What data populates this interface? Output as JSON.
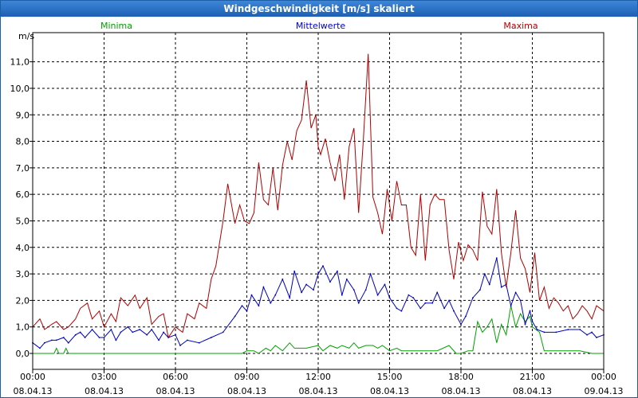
{
  "window": {
    "title": "Windgeschwindigkeit [m/s] skaliert"
  },
  "chart_data": {
    "type": "line",
    "title": "Windgeschwindigkeit [m/s] skaliert",
    "ylabel": "m/s",
    "ylim": [
      -0.6,
      12.1
    ],
    "xlim": [
      0,
      24
    ],
    "yticks": [
      "0,0",
      "1,0",
      "2,0",
      "3,0",
      "4,0",
      "5,0",
      "6,0",
      "7,0",
      "8,0",
      "9,0",
      "10,0",
      "11,0"
    ],
    "xticks": [
      {
        "time": "00:00",
        "date": "08.04.13"
      },
      {
        "time": "03:00",
        "date": "08.04.13"
      },
      {
        "time": "06:00",
        "date": "08.04.13"
      },
      {
        "time": "09:00",
        "date": "08.04.13"
      },
      {
        "time": "12:00",
        "date": "08.04.13"
      },
      {
        "time": "15:00",
        "date": "08.04.13"
      },
      {
        "time": "18:00",
        "date": "08.04.13"
      },
      {
        "time": "21:00",
        "date": "08.04.13"
      },
      {
        "time": "00:00",
        "date": "09.04.13"
      }
    ],
    "grid": true,
    "legend_position": "top",
    "series": [
      {
        "name": "Minima",
        "color": "#00a000",
        "x": [
          0,
          0.5,
          0.9,
          1.0,
          1.1,
          1.3,
          1.4,
          1.5,
          1.7,
          2,
          3,
          4,
          5,
          6,
          7,
          7.5,
          8,
          8.5,
          8.8,
          9,
          9.3,
          9.5,
          9.8,
          10,
          10.2,
          10.5,
          10.8,
          11,
          11.5,
          12,
          12.2,
          12.5,
          12.8,
          13,
          13.3,
          13.5,
          13.7,
          14,
          14.3,
          14.5,
          14.7,
          15,
          15.3,
          15.5,
          16,
          16.5,
          17,
          17.5,
          17.8,
          18,
          18.3,
          18.5,
          18.7,
          18.9,
          19.1,
          19.3,
          19.5,
          19.7,
          19.9,
          20.1,
          20.3,
          20.5,
          20.7,
          20.9,
          21,
          21.3,
          21.5,
          22,
          22.5,
          23,
          23.5,
          24
        ],
        "y": [
          0,
          0,
          0,
          0.2,
          0,
          0,
          0.2,
          0,
          0,
          0,
          0,
          0,
          0,
          0,
          0,
          0,
          0,
          0,
          0,
          0.1,
          0.1,
          0,
          0.2,
          0.1,
          0.3,
          0.1,
          0.4,
          0.2,
          0.2,
          0.3,
          0.1,
          0.3,
          0.2,
          0.3,
          0.2,
          0.4,
          0.2,
          0.3,
          0.3,
          0.2,
          0.3,
          0.1,
          0.2,
          0.1,
          0.1,
          0.1,
          0.1,
          0.3,
          0,
          0,
          0.1,
          0.1,
          1.2,
          0.8,
          1,
          1.3,
          0.4,
          1.1,
          0.7,
          1.8,
          1,
          1.5,
          1.2,
          1.4,
          1,
          0.8,
          0.1,
          0.1,
          0.1,
          0.1,
          0,
          0
        ]
      },
      {
        "name": "Mittelwerte",
        "color": "#0000c0",
        "x": [
          0,
          0.3,
          0.5,
          0.8,
          1.0,
          1.3,
          1.5,
          1.8,
          2,
          2.2,
          2.5,
          2.8,
          3,
          3.3,
          3.5,
          3.7,
          4,
          4.2,
          4.5,
          4.8,
          5,
          5.3,
          5.5,
          5.7,
          6,
          6.2,
          6.5,
          7,
          7.5,
          8,
          8.5,
          8.8,
          9,
          9.2,
          9.5,
          9.7,
          10,
          10.2,
          10.5,
          10.8,
          11,
          11.3,
          11.5,
          11.8,
          12,
          12.2,
          12.5,
          12.8,
          13,
          13.2,
          13.5,
          13.7,
          14,
          14.2,
          14.5,
          14.8,
          15,
          15.3,
          15.5,
          15.8,
          16,
          16.3,
          16.5,
          16.8,
          17,
          17.3,
          17.5,
          17.7,
          18,
          18.2,
          18.5,
          18.8,
          19,
          19.2,
          19.5,
          19.7,
          19.9,
          20.1,
          20.3,
          20.5,
          20.7,
          20.9,
          21,
          21.2,
          21.5,
          22,
          22.5,
          23,
          23.3,
          23.5,
          23.7,
          24
        ],
        "y": [
          0.4,
          0.2,
          0.4,
          0.5,
          0.5,
          0.6,
          0.4,
          0.7,
          0.8,
          0.6,
          0.9,
          0.6,
          0.6,
          0.9,
          0.5,
          0.8,
          1.0,
          0.8,
          0.9,
          0.7,
          0.9,
          0.5,
          0.8,
          0.6,
          0.7,
          0.3,
          0.5,
          0.4,
          0.6,
          0.8,
          1.4,
          1.8,
          1.6,
          2.2,
          1.8,
          2.5,
          1.9,
          2.2,
          2.8,
          2.1,
          3.1,
          2.3,
          2.6,
          2.4,
          3.0,
          3.3,
          2.7,
          3.1,
          2.2,
          2.8,
          2.4,
          1.9,
          2.4,
          3.0,
          2.2,
          2.6,
          2.1,
          1.7,
          1.6,
          2.2,
          2.1,
          1.7,
          1.9,
          1.9,
          2.3,
          1.7,
          2.0,
          1.6,
          1.1,
          1.4,
          2.1,
          2.4,
          3.0,
          2.6,
          3.6,
          2.5,
          2.6,
          1.8,
          2.3,
          2.0,
          1.1,
          1.6,
          1.2,
          0.9,
          0.8,
          0.8,
          0.9,
          0.9,
          0.7,
          0.8,
          0.6,
          0.7
        ],
        "marked": true
      },
      {
        "name": "Maxima",
        "color": "#b00000",
        "x": [
          0,
          0.3,
          0.5,
          0.8,
          1.0,
          1.3,
          1.5,
          1.8,
          2,
          2.3,
          2.5,
          2.8,
          3,
          3.3,
          3.5,
          3.7,
          4,
          4.3,
          4.5,
          4.8,
          5,
          5.3,
          5.5,
          5.7,
          6,
          6.3,
          6.5,
          6.8,
          7,
          7.3,
          7.5,
          7.7,
          8,
          8.2,
          8.5,
          8.7,
          8.9,
          9.1,
          9.3,
          9.5,
          9.7,
          9.9,
          10.1,
          10.3,
          10.5,
          10.7,
          10.9,
          11.1,
          11.3,
          11.5,
          11.7,
          11.9,
          12.0,
          12.1,
          12.3,
          12.5,
          12.7,
          12.9,
          13.1,
          13.3,
          13.5,
          13.7,
          13.9,
          14.1,
          14.3,
          14.5,
          14.7,
          14.9,
          15.1,
          15.3,
          15.5,
          15.7,
          15.9,
          16.1,
          16.3,
          16.5,
          16.7,
          16.9,
          17.1,
          17.3,
          17.5,
          17.7,
          17.9,
          18.1,
          18.3,
          18.5,
          18.7,
          18.9,
          19.1,
          19.3,
          19.5,
          19.7,
          19.9,
          20.1,
          20.3,
          20.5,
          20.7,
          20.9,
          21.1,
          21.3,
          21.5,
          21.7,
          21.9,
          22.1,
          22.3,
          22.5,
          22.7,
          22.9,
          23.1,
          23.3,
          23.5,
          23.7,
          24
        ],
        "y": [
          1.0,
          1.3,
          0.9,
          1.1,
          1.2,
          0.9,
          1.0,
          1.3,
          1.7,
          1.9,
          1.3,
          1.6,
          1.0,
          1.5,
          1.2,
          2.1,
          1.8,
          2.2,
          1.7,
          2.1,
          1.1,
          1.4,
          1.5,
          0.6,
          1.0,
          0.8,
          1.5,
          1.3,
          1.9,
          1.7,
          2.8,
          3.3,
          5.0,
          6.4,
          4.9,
          5.6,
          5.0,
          4.9,
          5.3,
          7.2,
          5.8,
          5.6,
          7.0,
          5.4,
          7.1,
          8.0,
          7.3,
          8.4,
          8.8,
          10.3,
          8.5,
          9.0,
          7.8,
          7.5,
          8.1,
          7.2,
          6.5,
          7.5,
          5.8,
          7.8,
          8.5,
          5.3,
          8.1,
          11.3,
          5.9,
          5.3,
          4.5,
          6.2,
          5.0,
          6.5,
          5.6,
          5.6,
          4.0,
          3.7,
          6.0,
          3.5,
          5.6,
          6.0,
          5.8,
          5.8,
          3.9,
          2.8,
          4.2,
          3.5,
          4.1,
          3.9,
          3.5,
          6.1,
          4.8,
          4.5,
          6.2,
          3.8,
          2.5,
          3.8,
          5.4,
          3.6,
          3.2,
          2.3,
          3.8,
          2.0,
          2.5,
          1.7,
          2.1,
          1.9,
          1.6,
          1.8,
          1.3,
          1.5,
          1.8,
          1.6,
          1.3,
          1.8,
          1.6
        ]
      }
    ]
  }
}
